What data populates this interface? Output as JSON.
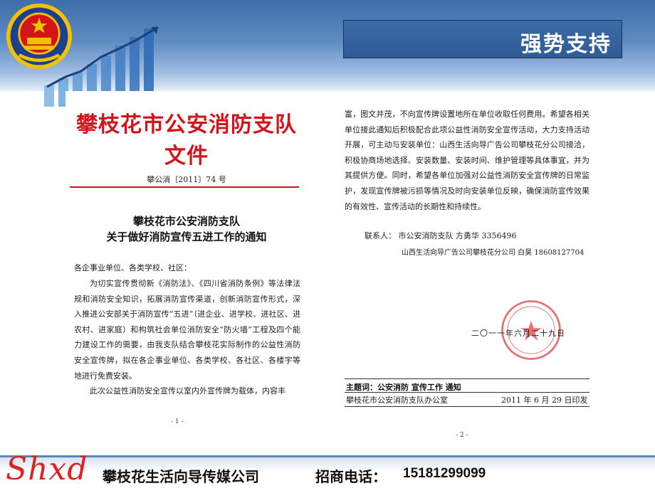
{
  "slide": {
    "title": "强势支持"
  },
  "page1": {
    "header_title": "攀枝花市公安消防支队文件",
    "doc_number": "攀公消〔2011〕74 号",
    "notice_title_line1": "攀枝花市公安消防支队",
    "notice_title_line2": "关于做好消防宣传五进工作的通知",
    "salutation": "各企事业单位、各类学校、社区：",
    "paragraph1": "为切实宣传贯彻新《消防法》、《四川省消防条例》等法律法规和消防安全知识，拓展消防宣传渠道，创新消防宣传形式，深入推进公安部关于消防宣传“五进”（进企业、进学校、进社区、进农村、进家庭）和构筑社会单位消防安全“防火墙”工程及四个能力建设工作的需要，由我支队结合攀枝花实际制作的公益性消防安全宣传牌，拟在各企事业单位、各类学校、各社区、各楼宇等地进行免费安装。",
    "paragraph2": "此次公益性消防安全宣传以室内外宣传牌为载体，内容丰",
    "page_number": "- 1 -"
  },
  "page2": {
    "paragraph": "富，图文并茂，不向宣传牌设置地所在单位收取任何费用。希望各相关单位接此通知后积极配合此项公益性消防安全宣传活动，大力支持活动开展，可主动与安装单位：山西生活向导广告公司攀枝花分公司接洽，积极协商场地选择、安装数量、安装时间、维护管理等具体事宜，并为其提供方便。同时，希望各单位加强对公益性消防安全宣传牌的日常监护，发现宣传牌被污损等情况及时向安装单位反映，确保消防宣传效果的有效性、宣传活动的长期性和持续性。",
    "contact_line1": "联系人：  市公安消防支队    方勇华    3356496",
    "contact_line2": "山西生活向导广告公司攀枝花分公司 白昊  18608127704",
    "date": "二〇一一年六月二十九日",
    "keywords": "主题词：公安消防   宣传工作   通知",
    "issuer": "攀枝花市公安消防支队办公室",
    "issue_date": "2011 年 6 月 29 日印发",
    "page_number": "- 2 -"
  },
  "footer": {
    "brand": "Shxd",
    "company": "攀枝花生活向导传媒公司",
    "phone_label": "招商电话：",
    "phone": "15181299099"
  },
  "colors": {
    "header_blue": "#3f6ea8",
    "doc_red": "#d4141b",
    "brand_red": "#e0201e"
  },
  "icons": {
    "emblem": "police-emblem-icon",
    "growth": "growth-bar-chart-graphic",
    "seal": "official-seal-icon"
  }
}
